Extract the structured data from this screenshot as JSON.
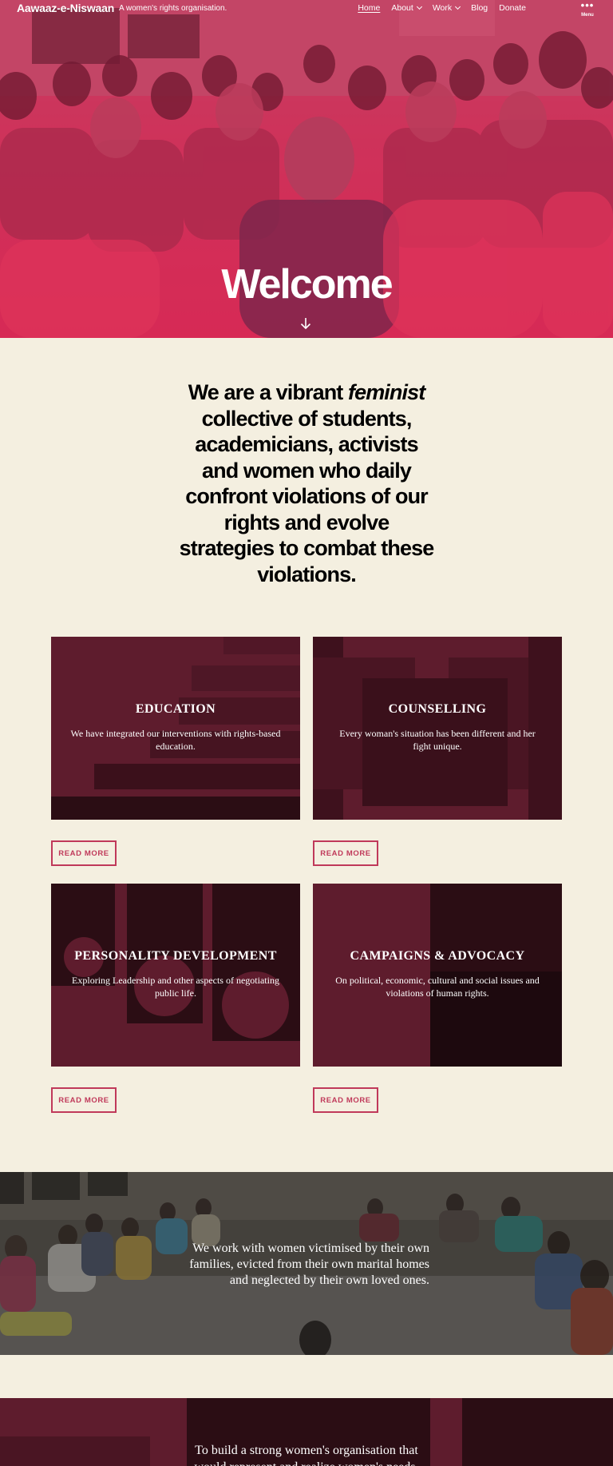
{
  "header": {
    "site_title": "Aawaaz-e-Niswaan",
    "site_description": "A women's rights organisation.",
    "nav": [
      {
        "label": "Home",
        "active": true,
        "has_submenu": false
      },
      {
        "label": "About",
        "active": false,
        "has_submenu": true
      },
      {
        "label": "Work",
        "active": false,
        "has_submenu": true
      },
      {
        "label": "Blog",
        "active": false,
        "has_submenu": false
      },
      {
        "label": "Donate",
        "active": false,
        "has_submenu": false
      }
    ],
    "menu_icon": "more-dots-icon",
    "menu_label": "Menu"
  },
  "hero": {
    "title": "Welcome",
    "scroll_icon": "arrow-down-icon"
  },
  "intro": {
    "text_before": "We are a vibrant ",
    "emphasis": "feminist",
    "text_after": " collective of students, academicians, activists and women who daily confront violations of our rights and evolve strategies to combat these violations."
  },
  "cards": [
    {
      "title": "EDUCATION",
      "text": "We have integrated our interventions with rights-based education.",
      "button": "READ MORE"
    },
    {
      "title": "COUNSELLING",
      "text": "Every woman's situation has been different and her fight unique.",
      "button": "READ MORE"
    },
    {
      "title": "PERSONALITY DEVELOPMENT",
      "text": "Exploring Leadership and other aspects of negotiating public life.",
      "button": "READ MORE"
    },
    {
      "title": "CAMPAIGNS & ADVOCACY",
      "text": "On political, economic, cultural and social issues and violations of human rights.",
      "button": "READ MORE"
    }
  ],
  "band": {
    "text": "We work with women victimised by their own families, evicted from their own marital homes and neglected by their own loved ones."
  },
  "mission": {
    "text": "To build a strong women's organisation that would represent and realize women's needs, aspirations and"
  },
  "colors": {
    "hero_overlay": "#d42b55",
    "page_background": "#f4efe0",
    "card_background": "#5e1c2d",
    "card_dark": "#2b0d14",
    "accent": "#c0395a"
  }
}
